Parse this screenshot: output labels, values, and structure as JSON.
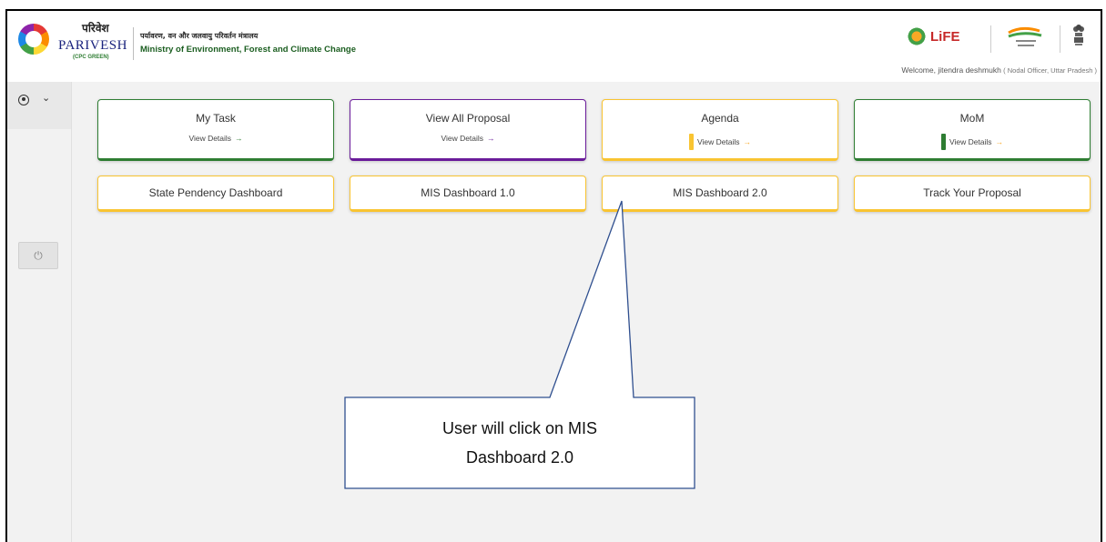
{
  "header": {
    "logo_hindi": "परिवेश",
    "logo_name": "PARIVESH",
    "logo_sub": "(CPC GREEN)",
    "ministry_hindi": "पर्यावरण, वन और जलवायु परिवर्तन मंत्रालय",
    "ministry_english": "Ministry of Environment, Forest and Climate Change",
    "life_logo_text": "LiFE",
    "welcome_text": "Welcome, jitendra deshmukh",
    "welcome_role": "( Nodal Officer, Uttar Pradesh )"
  },
  "sidebar": {
    "user_icon": "user-circle-icon",
    "expand_icon": "chevron-down-icon",
    "chevron_glyph": "⌄",
    "power_icon": "power-icon",
    "power_glyph": "⏻"
  },
  "dashboard": {
    "top_cards": [
      {
        "title": "My Task",
        "link": "View Details",
        "arrow": "→",
        "accent": "#2e7d32"
      },
      {
        "title": "View All Proposal",
        "link": "View Details",
        "arrow": "→",
        "accent": "#6a1b9a"
      },
      {
        "title": "Agenda",
        "link": "View Details",
        "arrow": "→",
        "accent": "#f9c431"
      },
      {
        "title": "MoM",
        "link": "View Details",
        "arrow": "→",
        "accent": "#2e7d32"
      }
    ],
    "bottom_cards": [
      {
        "title": "State Pendency Dashboard"
      },
      {
        "title": "MIS Dashboard 1.0"
      },
      {
        "title": "MIS Dashboard 2.0"
      },
      {
        "title": "Track Your Proposal"
      }
    ]
  },
  "callout": {
    "line1": "User will click on MIS",
    "line2": "Dashboard 2.0"
  },
  "colors": {
    "green": "#2e7d32",
    "purple": "#6a1b9a",
    "yellow": "#f9c431",
    "background": "#f2f2f2"
  }
}
